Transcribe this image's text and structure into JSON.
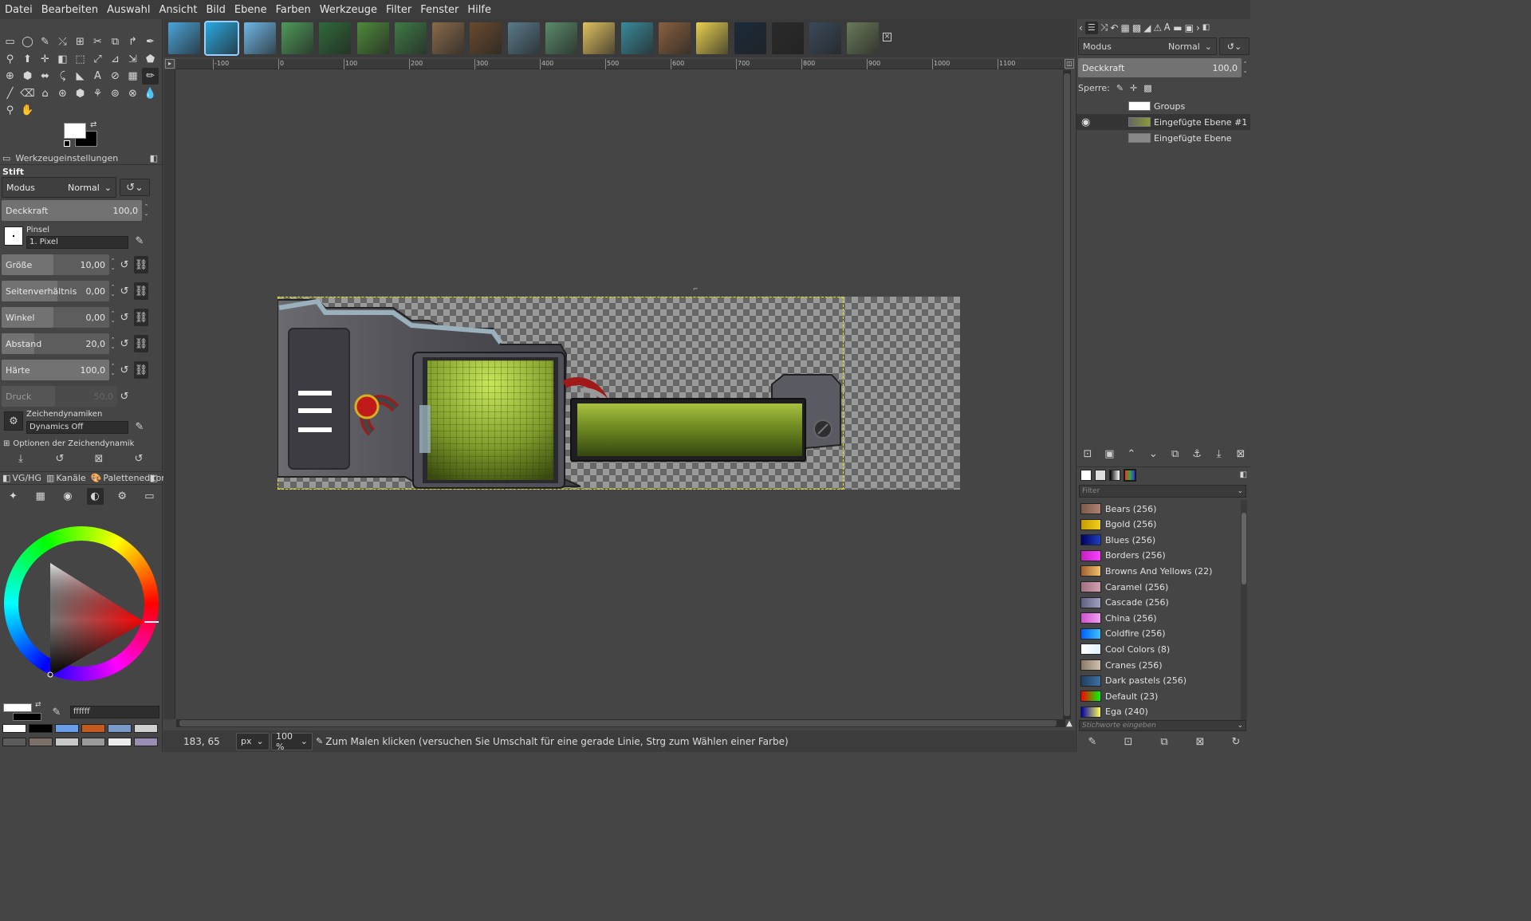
{
  "menu": [
    "Datei",
    "Bearbeiten",
    "Auswahl",
    "Ansicht",
    "Bild",
    "Ebene",
    "Farben",
    "Werkzeuge",
    "Filter",
    "Fenster",
    "Hilfe"
  ],
  "toolbox": {
    "rows": [
      [
        "▭",
        "◯",
        "✎",
        "⤯",
        "⊞",
        "✂",
        "⧉",
        "↱",
        "✒"
      ],
      [
        "⚲",
        "⬆",
        "✛",
        "◧",
        "⬚",
        "⤢",
        "⊿",
        "⇲",
        "⬟"
      ],
      [
        "⊕",
        "⬢",
        "⬌",
        "⤹",
        "◣",
        "A",
        "⊘",
        "▦",
        "✏"
      ],
      [
        "╱",
        "⌫",
        "⌂",
        "⊛",
        "⬢",
        "⚘",
        "⊚",
        "⊗",
        "💧"
      ],
      [
        "⚲",
        "✋"
      ]
    ]
  },
  "tool_options": {
    "tab_label": "Werkzeugeinstellungen",
    "tool_name": "Stift",
    "mode_label": "Modus",
    "mode_value": "Normal",
    "opacity_label": "Deckkraft",
    "opacity_value": "100,0",
    "brush_label": "Pinsel",
    "brush_value": "1. Pixel",
    "size_label": "Größe",
    "size_value": "10,00",
    "aspect_label": "Seitenverhältnis",
    "aspect_value": "0,00",
    "angle_label": "Winkel",
    "angle_value": "0,00",
    "spacing_label": "Abstand",
    "spacing_value": "20,0",
    "hardness_label": "Härte",
    "hardness_value": "100,0",
    "pressure_label": "Druck",
    "pressure_value": "50,0",
    "dynamics_label": "Zeichendynamiken",
    "dynamics_value": "Dynamics Off",
    "dynamics_options_label": "Optionen der Zeichendynamik"
  },
  "color_dock": {
    "tabs": [
      "VG/HG",
      "Kanäle",
      "Paletteneditor"
    ],
    "hex_value": "ffffff",
    "quick_colors": [
      "#ffffff",
      "#000000",
      "#6a9ee8",
      "#c45a1c",
      "#7a9acb",
      "#d0d0d0",
      "#5c5c5c",
      "#7c7068",
      "#c8c8c8",
      "#9a9a9a",
      "#ececec",
      "#9a8eb4"
    ]
  },
  "image_tabs": [
    {
      "color": "#4aa3d9"
    },
    {
      "color": "#2aa8e0"
    },
    {
      "color": "#6fb7e6"
    },
    {
      "color": "#4f9a5a"
    },
    {
      "color": "#2f6a3a"
    },
    {
      "color": "#4e8a3a"
    },
    {
      "color": "#3f7a46"
    },
    {
      "color": "#8a6a4a"
    },
    {
      "color": "#6a4a2e"
    },
    {
      "color": "#5a7a8a"
    },
    {
      "color": "#5a8a6a"
    },
    {
      "color": "#e0c060"
    },
    {
      "color": "#3a8a9a"
    },
    {
      "color": "#8a6040"
    },
    {
      "color": "#e8d050"
    },
    {
      "color": "#1a2a3a"
    },
    {
      "color": "#2a2a2a"
    },
    {
      "color": "#3a4a5a"
    },
    {
      "color": "#6a7a5a"
    }
  ],
  "ruler_h_labels": [
    "-100",
    "0",
    "100",
    "200",
    "300",
    "400",
    "500",
    "600",
    "700",
    "800",
    "900",
    "1000",
    "1100"
  ],
  "status": {
    "coords": "183, 65",
    "unit": "px",
    "zoom": "100 %",
    "message": "Zum Malen klicken (versuchen Sie Umschalt für eine gerade Linie, Strg zum Wählen einer Farbe)"
  },
  "layers_panel": {
    "mode_label": "Modus",
    "mode_value": "Normal",
    "opacity_label": "Deckkraft",
    "opacity_value": "100,0",
    "lock_label": "Sperre:",
    "layers": [
      {
        "name": "Groups",
        "visible": false,
        "selected": false
      },
      {
        "name": "Eingefügte Ebene #1",
        "visible": true,
        "selected": true
      },
      {
        "name": "Eingefügte Ebene",
        "visible": false,
        "selected": false
      }
    ]
  },
  "palettes_panel": {
    "filter_placeholder": "Filter",
    "tag_placeholder": "Stichworte eingeben",
    "palettes": [
      {
        "name": "Bears (256)",
        "c1": "#7a5a4a",
        "c2": "#b08070"
      },
      {
        "name": "Bgold (256)",
        "c1": "#c89a00",
        "c2": "#f0d020"
      },
      {
        "name": "Blues (256)",
        "c1": "#000060",
        "c2": "#2040c0"
      },
      {
        "name": "Borders (256)",
        "c1": "#c020c0",
        "c2": "#ff40ff"
      },
      {
        "name": "Browns And Yellows (22)",
        "c1": "#a06030",
        "c2": "#f0c070"
      },
      {
        "name": "Caramel (256)",
        "c1": "#a07080",
        "c2": "#d0a0b0"
      },
      {
        "name": "Cascade (256)",
        "c1": "#606080",
        "c2": "#a0a0c0"
      },
      {
        "name": "China (256)",
        "c1": "#d050d0",
        "c2": "#f0a0f0"
      },
      {
        "name": "Coldfire (256)",
        "c1": "#0060ff",
        "c2": "#40c0ff"
      },
      {
        "name": "Cool Colors (8)",
        "c1": "#ffffff",
        "c2": "#e0f0ff"
      },
      {
        "name": "Cranes (256)",
        "c1": "#8a7a6a",
        "c2": "#d0c0b0"
      },
      {
        "name": "Dark pastels (256)",
        "c1": "#204060",
        "c2": "#4070a0"
      },
      {
        "name": "Default (23)",
        "c1": "#ff0000",
        "c2": "#00ff00"
      },
      {
        "name": "Ega (240)",
        "c1": "#0000aa",
        "c2": "#ffff55"
      }
    ]
  }
}
